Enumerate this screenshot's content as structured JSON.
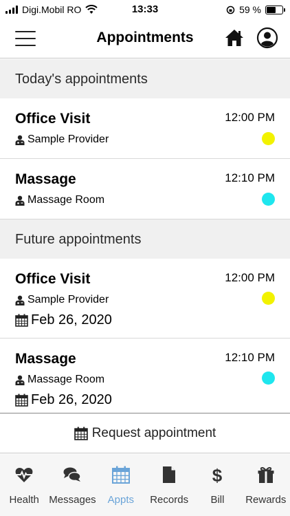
{
  "status_bar": {
    "carrier": "Digi.Mobil RO",
    "time": "13:33",
    "battery_text": "59 %",
    "battery_level": 0.59
  },
  "header": {
    "title": "Appointments"
  },
  "sections": {
    "today_title": "Today's appointments",
    "future_title": "Future appointments"
  },
  "today": [
    {
      "title": "Office Visit",
      "time": "12:00 PM",
      "location": "Sample Provider",
      "color": "#f2f200"
    },
    {
      "title": "Massage",
      "time": "12:10 PM",
      "location": "Massage Room",
      "color": "#1ee6ee"
    }
  ],
  "future": [
    {
      "title": "Office Visit",
      "time": "12:00 PM",
      "location": "Sample Provider",
      "date": "Feb 26, 2020",
      "color": "#f2f200"
    },
    {
      "title": "Massage",
      "time": "12:10 PM",
      "location": "Massage Room",
      "date": "Feb 26, 2020",
      "color": "#1ee6ee"
    }
  ],
  "request_button": {
    "label": "Request appointment"
  },
  "tabs": [
    {
      "label": "Health",
      "icon": "heartbeat-icon"
    },
    {
      "label": "Messages",
      "icon": "chat-bubbles-icon"
    },
    {
      "label": "Appts",
      "icon": "calendar-icon",
      "active": true
    },
    {
      "label": "Records",
      "icon": "document-icon"
    },
    {
      "label": "Bill",
      "icon": "dollar-icon"
    },
    {
      "label": "Rewards",
      "icon": "gift-icon"
    }
  ],
  "colors": {
    "active_tab": "#6aa4d8"
  }
}
